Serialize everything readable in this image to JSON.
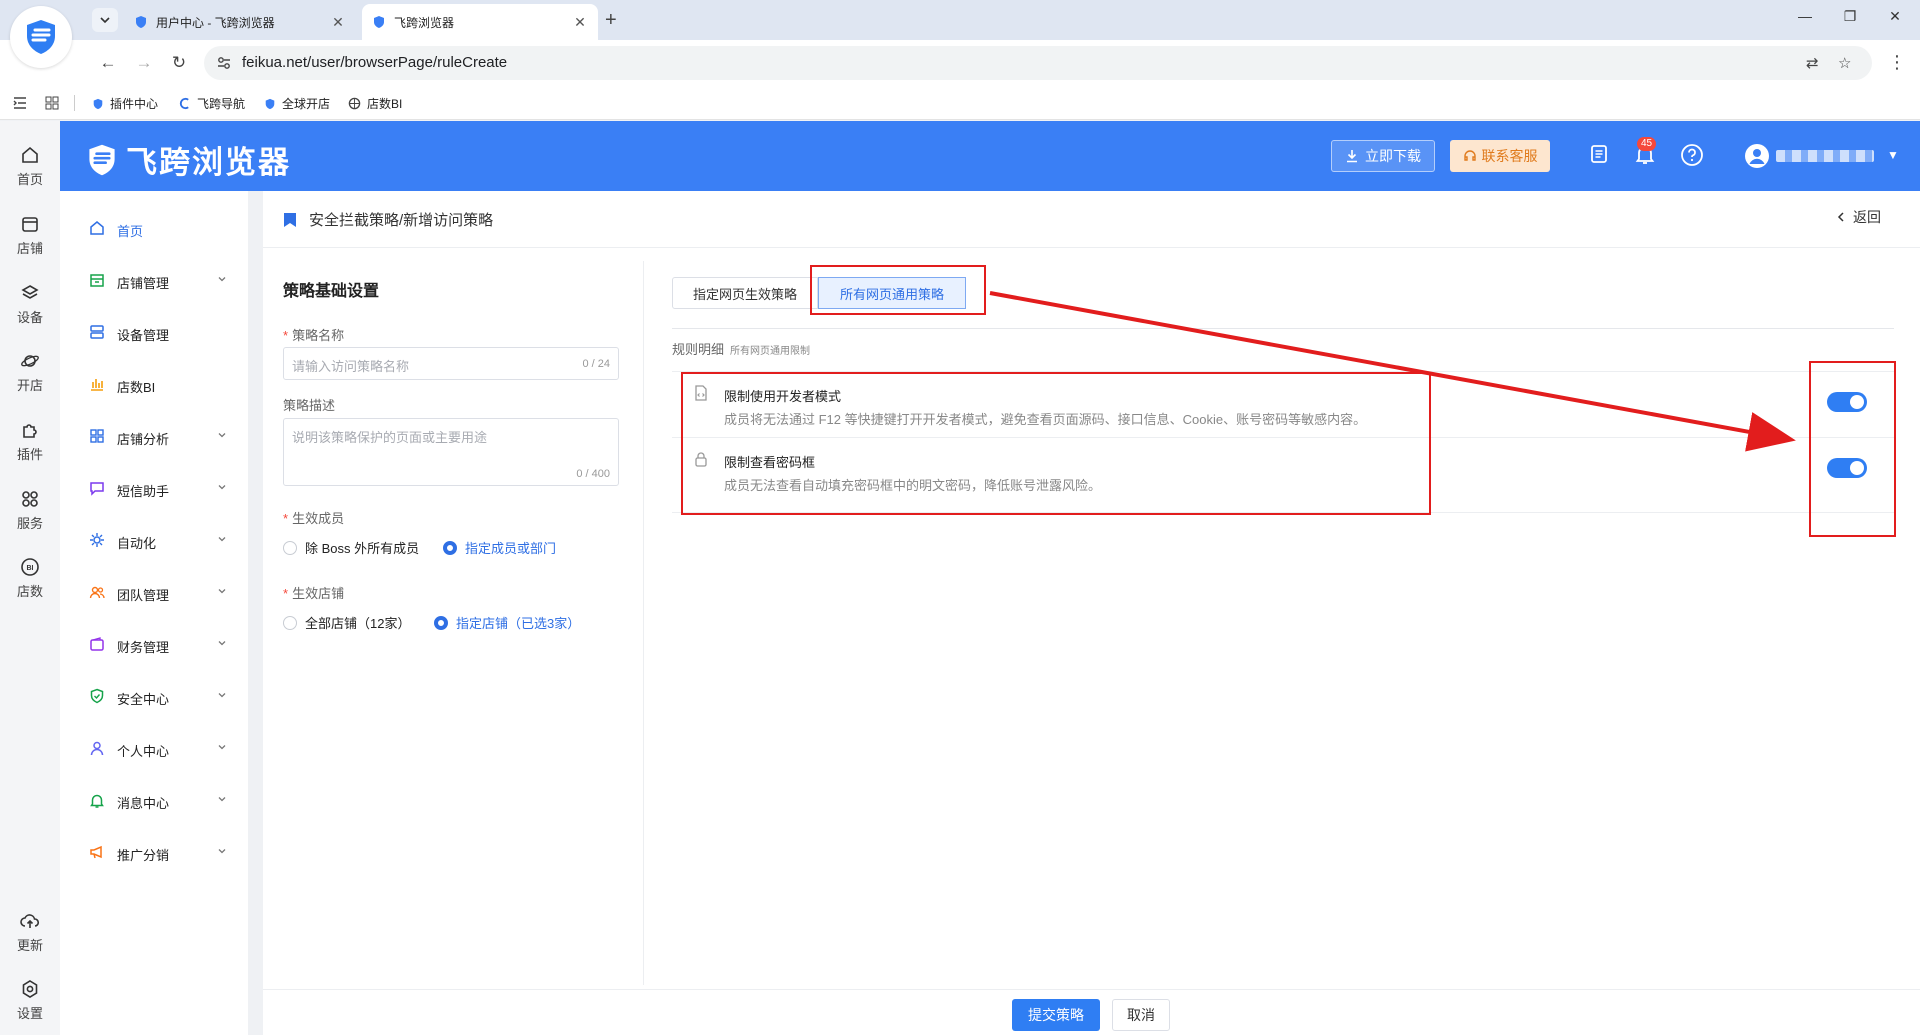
{
  "browser": {
    "tabs": [
      {
        "title": "用户中心 - 飞跨浏览器"
      },
      {
        "title": "飞跨浏览器"
      }
    ],
    "url": "feikua.net/user/browserPage/ruleCreate",
    "bookmarks": [
      "插件中心",
      "飞跨导航",
      "全球开店",
      "店数BI"
    ]
  },
  "header": {
    "brand": "飞跨浏览器",
    "download_label": "立即下载",
    "service_label": "联系客服",
    "notification_count": "45"
  },
  "rail": {
    "top": [
      "首页",
      "店铺",
      "设备",
      "开店",
      "插件",
      "服务",
      "店数"
    ],
    "bottom": [
      "更新",
      "设置"
    ]
  },
  "menu": [
    {
      "label": "首页",
      "icon": "home-icon",
      "active": true
    },
    {
      "label": "店铺管理",
      "icon": "shop-icon"
    },
    {
      "label": "设备管理",
      "icon": "device-icon"
    },
    {
      "label": "店数BI",
      "icon": "bar-chart-icon"
    },
    {
      "label": "店铺分析",
      "icon": "grid-icon"
    },
    {
      "label": "短信助手",
      "icon": "message-icon"
    },
    {
      "label": "自动化",
      "icon": "automation-icon"
    },
    {
      "label": "团队管理",
      "icon": "team-icon"
    },
    {
      "label": "财务管理",
      "icon": "wallet-icon"
    },
    {
      "label": "安全中心",
      "icon": "shield-icon"
    },
    {
      "label": "个人中心",
      "icon": "user-icon"
    },
    {
      "label": "消息中心",
      "icon": "bell-icon"
    },
    {
      "label": "推广分销",
      "icon": "megaphone-icon"
    }
  ],
  "page": {
    "breadcrumb": "安全拦截策略/新增访问策略",
    "back_label": "返回"
  },
  "form": {
    "title": "策略基础设置",
    "name_label": "策略名称",
    "name_placeholder": "请输入访问策略名称",
    "name_count": "0 / 24",
    "desc_label": "策略描述",
    "desc_placeholder": "说明该策略保护的页面或主要用途",
    "desc_count": "0 / 400",
    "members_label": "生效成员",
    "members_options": [
      "除 Boss 外所有成员",
      "指定成员或部门"
    ],
    "members_selected": "指定成员或部门",
    "shops_label": "生效店铺",
    "shops_options": [
      "全部店铺（12家）",
      "指定店铺（已选3家）"
    ],
    "shops_selected": "指定店铺（已选3家）"
  },
  "policy_tabs": [
    "指定网页生效策略",
    "所有网页通用策略"
  ],
  "policy_tab_active": "所有网页通用策略",
  "rules": {
    "caption": "规则明细",
    "caption_sub": "所有网页通用限制",
    "items": [
      {
        "title": "限制使用开发者模式",
        "desc": "成员将无法通过 F12 等快捷键打开开发者模式，避免查看页面源码、接口信息、Cookie、账号密码等敏感内容。",
        "enabled": true
      },
      {
        "title": "限制查看密码框",
        "desc": "成员无法查看自动填充密码框中的明文密码，降低账号泄露风险。",
        "enabled": true
      }
    ]
  },
  "footer": {
    "submit_label": "提交策略",
    "cancel_label": "取消"
  },
  "colors": {
    "primary": "#2f7ef3",
    "header_bg": "#3a7ff5",
    "annotation_red": "#e21d1d",
    "service_bg": "#fde6cf"
  }
}
